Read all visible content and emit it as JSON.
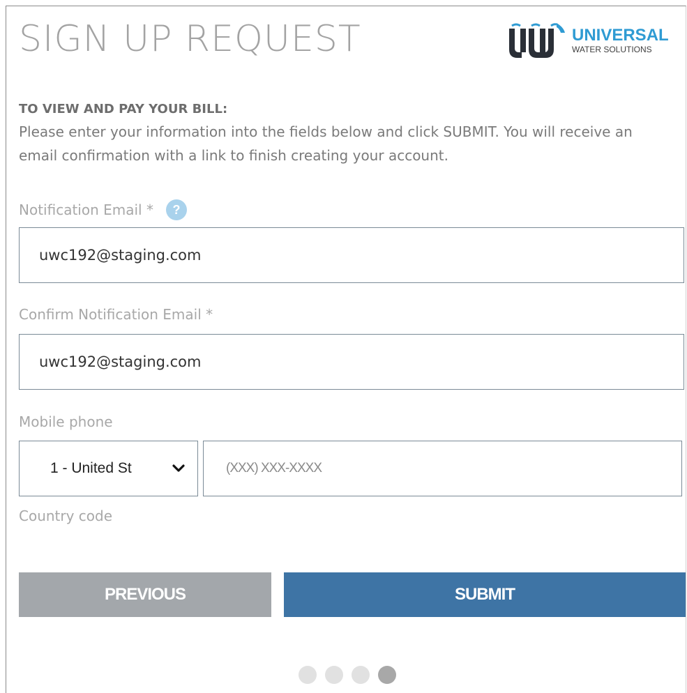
{
  "header": {
    "title": "SIGN UP REQUEST",
    "logo": {
      "word1": "UNIVERSAL",
      "word2": "WATER SOLUTIONS",
      "colors": {
        "primary": "#2f9bd3",
        "dark": "#2a2f37"
      }
    }
  },
  "intro": {
    "heading": "TO VIEW AND PAY YOUR BILL:",
    "body": "Please enter your information into the fields below and click SUBMIT. You will receive an email confirmation with a link to finish creating your account."
  },
  "form": {
    "notification_email": {
      "label": "Notification Email *",
      "help_icon": "?",
      "value": "uwc192@staging.com"
    },
    "confirm_email": {
      "label": "Confirm Notification Email *",
      "value": "uwc192@staging.com"
    },
    "mobile_phone": {
      "label": "Mobile phone",
      "country_select": "1 - United St",
      "placeholder": "(XXX) XXX-XXXX",
      "country_caption": "Country code"
    }
  },
  "buttons": {
    "previous": "PREVIOUS",
    "submit": "SUBMIT"
  },
  "pagination": {
    "total_steps": 4,
    "active_step": 4
  },
  "colors": {
    "submit_bg": "#3e74a5",
    "previous_bg": "#a3a7ab",
    "help_icon_bg": "#a9d2ec",
    "dot_active": "#a8a8a8",
    "dot_inactive": "#e1e1e1"
  }
}
